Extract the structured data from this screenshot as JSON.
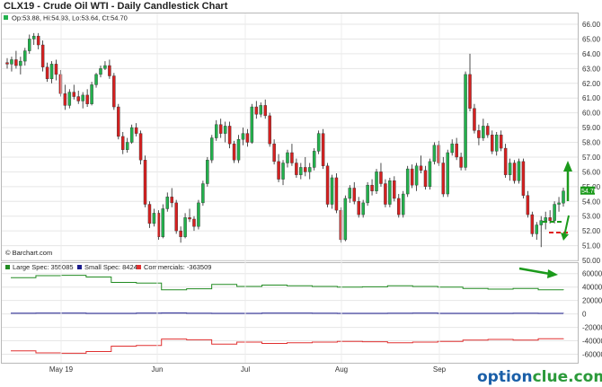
{
  "chart_data": [
    {
      "type": "candlestick",
      "title": "CLX19 - Crude Oil WTI - Daily Candlestick Chart",
      "legend_text": "Op:53.88, Hi:54.93, Lo:53.64, Ct:54.70",
      "last_price_label": "54.70",
      "source_label": "© Barchart.com",
      "ylim": [
        50.0,
        66.0
      ],
      "y_ticks": [
        "66.00",
        "65.00",
        "64.00",
        "63.00",
        "62.00",
        "61.00",
        "60.00",
        "59.00",
        "58.00",
        "57.00",
        "56.00",
        "55.00",
        "54.00",
        "53.00",
        "52.00",
        "51.00",
        "50.00"
      ],
      "x_ticks": [
        "May 19",
        "Jun",
        "Jul",
        "Aug",
        "Sep"
      ],
      "colors": {
        "up": "#22b14c",
        "down": "#d62020",
        "last_price_bg": "#1b9a1b"
      },
      "ohlc": [
        [
          63.4,
          63.7,
          63.0,
          63.3
        ],
        [
          63.3,
          63.8,
          62.8,
          63.6
        ],
        [
          63.6,
          64.2,
          63.0,
          63.2
        ],
        [
          63.2,
          63.8,
          62.6,
          63.5
        ],
        [
          63.5,
          64.4,
          63.2,
          64.2
        ],
        [
          64.2,
          65.3,
          64.0,
          65.0
        ],
        [
          65.0,
          65.4,
          64.6,
          65.2
        ],
        [
          65.2,
          65.4,
          64.3,
          64.6
        ],
        [
          64.6,
          64.9,
          62.8,
          63.1
        ],
        [
          63.1,
          63.4,
          62.1,
          62.3
        ],
        [
          62.3,
          63.5,
          62.0,
          63.3
        ],
        [
          63.3,
          63.6,
          62.2,
          62.6
        ],
        [
          62.6,
          62.9,
          61.1,
          61.3
        ],
        [
          61.3,
          61.9,
          60.2,
          60.5
        ],
        [
          60.5,
          61.6,
          60.3,
          61.4
        ],
        [
          61.4,
          61.9,
          60.9,
          61.1
        ],
        [
          61.1,
          61.5,
          60.6,
          60.8
        ],
        [
          60.8,
          61.4,
          60.3,
          61.2
        ],
        [
          61.2,
          61.6,
          60.4,
          60.6
        ],
        [
          60.6,
          62.1,
          60.5,
          61.9
        ],
        [
          61.9,
          62.7,
          61.7,
          62.6
        ],
        [
          62.6,
          63.2,
          62.4,
          63.0
        ],
        [
          63.0,
          63.5,
          62.9,
          63.2
        ],
        [
          63.2,
          63.6,
          62.3,
          62.5
        ],
        [
          62.5,
          62.7,
          60.2,
          60.4
        ],
        [
          60.4,
          60.6,
          58.2,
          58.4
        ],
        [
          58.4,
          58.7,
          57.2,
          57.5
        ],
        [
          57.5,
          58.3,
          57.3,
          58.0
        ],
        [
          58.0,
          59.2,
          57.9,
          59.0
        ],
        [
          59.0,
          59.3,
          58.4,
          58.6
        ],
        [
          58.6,
          58.8,
          56.5,
          56.8
        ],
        [
          56.8,
          57.1,
          53.6,
          53.8
        ],
        [
          53.8,
          54.0,
          52.2,
          52.5
        ],
        [
          52.5,
          53.5,
          52.3,
          53.2
        ],
        [
          53.2,
          53.4,
          51.4,
          51.6
        ],
        [
          51.6,
          53.8,
          51.5,
          53.5
        ],
        [
          53.5,
          54.6,
          53.3,
          54.3
        ],
        [
          54.3,
          54.9,
          53.6,
          53.9
        ],
        [
          53.9,
          54.1,
          51.8,
          52.0
        ],
        [
          52.0,
          52.3,
          51.2,
          51.6
        ],
        [
          51.6,
          53.2,
          51.5,
          52.9
        ],
        [
          52.9,
          53.5,
          52.6,
          52.8
        ],
        [
          52.8,
          53.0,
          52.0,
          52.3
        ],
        [
          52.3,
          54.1,
          52.1,
          53.9
        ],
        [
          53.9,
          55.4,
          53.7,
          55.2
        ],
        [
          55.2,
          57.0,
          55.0,
          56.8
        ],
        [
          56.8,
          58.5,
          56.6,
          58.3
        ],
        [
          58.3,
          59.5,
          58.1,
          59.2
        ],
        [
          59.2,
          59.6,
          58.3,
          58.6
        ],
        [
          58.6,
          59.4,
          58.0,
          59.1
        ],
        [
          59.1,
          59.4,
          57.6,
          57.9
        ],
        [
          57.9,
          58.1,
          56.6,
          56.8
        ],
        [
          56.8,
          58.5,
          56.6,
          58.2
        ],
        [
          58.2,
          59.0,
          57.8,
          58.6
        ],
        [
          58.6,
          58.9,
          57.7,
          58.0
        ],
        [
          58.0,
          60.6,
          57.9,
          60.4
        ],
        [
          60.4,
          60.8,
          59.6,
          59.9
        ],
        [
          59.9,
          60.7,
          59.7,
          60.5
        ],
        [
          60.5,
          60.9,
          59.6,
          59.8
        ],
        [
          59.8,
          60.0,
          57.7,
          57.9
        ],
        [
          57.9,
          58.2,
          56.5,
          56.7
        ],
        [
          56.7,
          57.2,
          55.3,
          55.5
        ],
        [
          55.5,
          56.8,
          55.1,
          56.6
        ],
        [
          56.6,
          57.5,
          56.3,
          57.3
        ],
        [
          57.3,
          57.9,
          56.4,
          56.6
        ],
        [
          56.6,
          56.9,
          55.6,
          55.8
        ],
        [
          55.8,
          56.6,
          55.5,
          56.3
        ],
        [
          56.3,
          57.0,
          55.7,
          56.0
        ],
        [
          56.0,
          56.6,
          55.5,
          56.3
        ],
        [
          56.3,
          57.6,
          56.1,
          57.4
        ],
        [
          57.4,
          58.8,
          57.2,
          58.6
        ],
        [
          58.6,
          58.9,
          56.2,
          56.4
        ],
        [
          56.4,
          56.6,
          53.6,
          53.8
        ],
        [
          53.8,
          55.8,
          53.5,
          55.6
        ],
        [
          55.6,
          55.9,
          53.2,
          53.4
        ],
        [
          53.4,
          53.6,
          51.2,
          51.4
        ],
        [
          51.4,
          54.4,
          51.3,
          54.2
        ],
        [
          54.2,
          55.1,
          53.9,
          54.9
        ],
        [
          54.9,
          55.3,
          53.8,
          54.0
        ],
        [
          54.0,
          54.3,
          52.9,
          53.1
        ],
        [
          53.1,
          54.1,
          52.9,
          53.9
        ],
        [
          53.9,
          55.3,
          53.7,
          55.1
        ],
        [
          55.1,
          55.5,
          54.4,
          54.7
        ],
        [
          54.7,
          56.2,
          54.5,
          56.0
        ],
        [
          56.0,
          56.6,
          55.0,
          55.2
        ],
        [
          55.2,
          55.5,
          53.6,
          53.8
        ],
        [
          53.8,
          55.6,
          53.6,
          55.4
        ],
        [
          55.4,
          55.7,
          54.0,
          54.2
        ],
        [
          54.2,
          54.5,
          52.9,
          53.1
        ],
        [
          53.1,
          54.7,
          52.9,
          54.5
        ],
        [
          54.5,
          56.4,
          54.3,
          56.2
        ],
        [
          56.2,
          56.5,
          54.9,
          55.1
        ],
        [
          55.1,
          56.6,
          54.7,
          56.4
        ],
        [
          56.4,
          57.1,
          55.9,
          56.1
        ],
        [
          56.1,
          56.4,
          54.8,
          55.0
        ],
        [
          55.0,
          56.9,
          54.8,
          56.7
        ],
        [
          56.7,
          58.0,
          56.5,
          57.8
        ],
        [
          57.8,
          58.1,
          56.4,
          56.6
        ],
        [
          56.6,
          57.0,
          54.3,
          54.5
        ],
        [
          54.5,
          57.5,
          54.3,
          57.3
        ],
        [
          57.3,
          58.2,
          57.1,
          57.9
        ],
        [
          57.9,
          58.3,
          56.8,
          57.0
        ],
        [
          57.0,
          57.3,
          56.1,
          56.3
        ],
        [
          56.3,
          62.8,
          56.1,
          62.6
        ],
        [
          62.6,
          64.0,
          60.1,
          60.3
        ],
        [
          60.3,
          60.6,
          58.6,
          58.8
        ],
        [
          58.8,
          59.2,
          57.8,
          58.3
        ],
        [
          58.3,
          59.6,
          58.1,
          59.1
        ],
        [
          59.1,
          59.3,
          58.3,
          58.5
        ],
        [
          58.5,
          58.8,
          57.2,
          57.4
        ],
        [
          57.4,
          58.7,
          57.1,
          58.5
        ],
        [
          58.5,
          58.8,
          57.4,
          57.6
        ],
        [
          57.6,
          57.9,
          55.6,
          55.8
        ],
        [
          55.8,
          56.9,
          55.4,
          56.6
        ],
        [
          56.6,
          56.8,
          55.2,
          55.4
        ],
        [
          55.4,
          56.9,
          55.2,
          56.7
        ],
        [
          56.7,
          56.9,
          54.2,
          54.4
        ],
        [
          54.4,
          54.7,
          52.9,
          53.1
        ],
        [
          53.1,
          53.3,
          51.6,
          51.8
        ],
        [
          51.8,
          52.6,
          51.4,
          52.4
        ],
        [
          52.4,
          53.0,
          50.9,
          52.7
        ],
        [
          52.7,
          53.3,
          52.1,
          52.9
        ],
        [
          52.9,
          53.4,
          52.5,
          52.7
        ],
        [
          52.7,
          54.0,
          52.5,
          53.8
        ],
        [
          53.8,
          54.3,
          53.3,
          53.9
        ],
        [
          53.88,
          54.93,
          53.64,
          54.7
        ]
      ]
    },
    {
      "type": "line",
      "series": [
        {
          "name": "Large Spec: 355085",
          "color": "#228b22",
          "values": [
            540000,
            570000,
            575000,
            550000,
            470000,
            460000,
            360000,
            375000,
            440000,
            410000,
            430000,
            420000,
            410000,
            400000,
            405000,
            420000,
            410000,
            400000,
            380000,
            370000,
            380000,
            360000,
            355085
          ]
        },
        {
          "name": "Small Spec: 8424",
          "color": "#1a1a8c",
          "values": [
            10000,
            12000,
            11000,
            9000,
            8000,
            12000,
            14000,
            10000,
            8000,
            9000,
            11000,
            12000,
            10000,
            9000,
            8000,
            10000,
            11000,
            9000,
            8000,
            9000,
            10000,
            9000,
            8424
          ]
        },
        {
          "name": "Commercials: -363509",
          "color": "#e03030",
          "values": [
            -550000,
            -580000,
            -585000,
            -560000,
            -480000,
            -470000,
            -375000,
            -385000,
            -450000,
            -420000,
            -440000,
            -430000,
            -420000,
            -410000,
            -415000,
            -430000,
            -420000,
            -410000,
            -390000,
            -380000,
            -390000,
            -370000,
            -363509
          ]
        }
      ],
      "ylim": [
        -700000,
        650000
      ],
      "y_ticks": [
        "600000",
        "400000",
        "200000",
        "0",
        "-200000",
        "-400000",
        "-600000"
      ],
      "y_tick_values": [
        600000,
        400000,
        200000,
        0,
        -200000,
        -400000,
        -600000
      ],
      "x_ticks": [
        "May 19",
        "Jun",
        "Jul",
        "Aug",
        "Sep"
      ]
    }
  ],
  "watermark": {
    "part1": "option",
    "part2": "clue.com"
  }
}
